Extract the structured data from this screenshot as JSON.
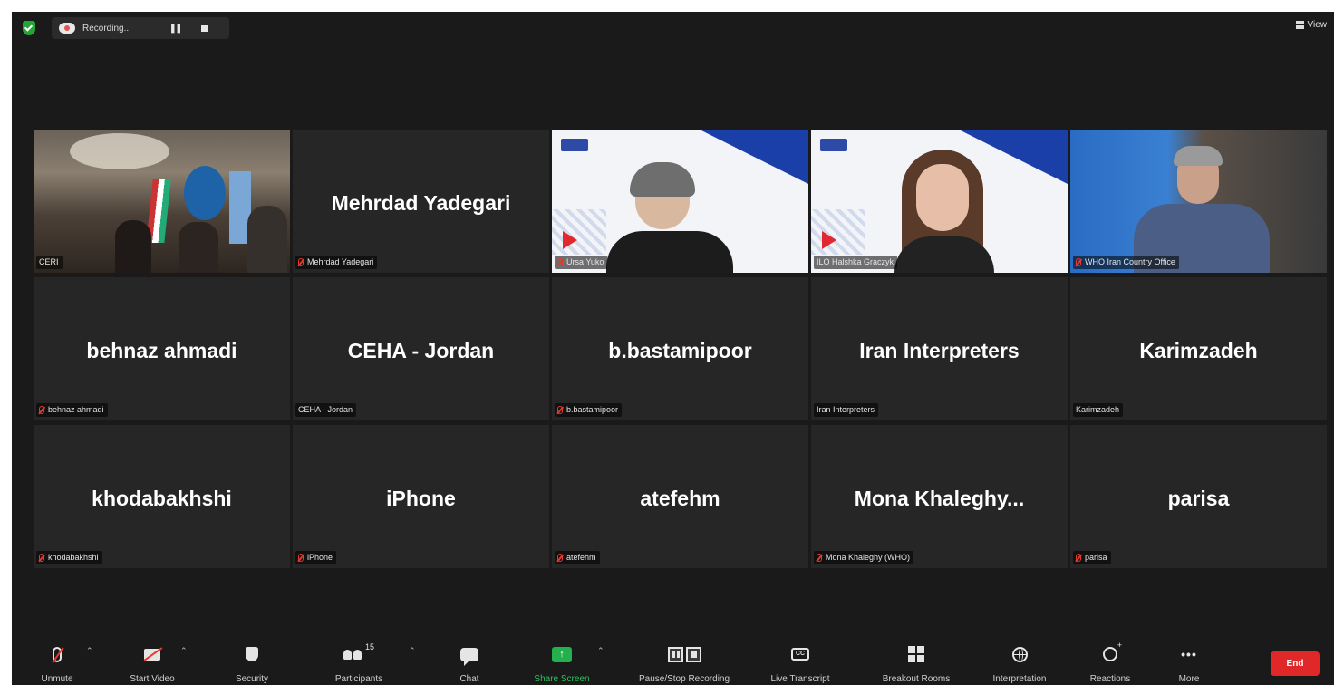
{
  "top_bar": {
    "recording_label": "Recording...",
    "view_label": "View"
  },
  "tiles": [
    {
      "label": "CERI",
      "video": "room",
      "active": true,
      "muted": false
    },
    {
      "name": "Mehrdad Yadegari",
      "label": "Mehrdad Yadegari",
      "muted": true
    },
    {
      "label": "Ursa Yuko",
      "video": "ilo-woman-short",
      "muted": true
    },
    {
      "label": "ILO Halshka Graczyk",
      "video": "ilo-woman-long",
      "muted": false
    },
    {
      "label": "WHO Iran Country Office",
      "video": "who-man",
      "muted": true
    },
    {
      "name": "behnaz ahmadi",
      "label": "behnaz ahmadi",
      "muted": true
    },
    {
      "name": "CEHA - Jordan",
      "label": "CEHA - Jordan",
      "muted": false
    },
    {
      "name": "b.bastamipoor",
      "label": "b.bastamipoor",
      "muted": true
    },
    {
      "name": "Iran Interpreters",
      "label": "Iran Interpreters",
      "muted": false
    },
    {
      "name": "Karimzadeh",
      "label": "Karimzadeh",
      "muted": false
    },
    {
      "name": "khodabakhshi",
      "label": "khodabakhshi",
      "muted": true
    },
    {
      "name": "iPhone",
      "label": "iPhone",
      "muted": true
    },
    {
      "name": "atefehm",
      "label": "atefehm",
      "muted": true
    },
    {
      "name": "Mona  Khaleghy...",
      "label": "Mona Khaleghy (WHO)",
      "muted": true
    },
    {
      "name": "parisa",
      "label": "parisa",
      "muted": true
    }
  ],
  "toolbar": {
    "unmute": "Unmute",
    "start_video": "Start Video",
    "security": "Security",
    "participants": "Participants",
    "participants_count": "15",
    "chat": "Chat",
    "share_screen": "Share Screen",
    "pause_stop_recording": "Pause/Stop Recording",
    "live_transcript": "Live Transcript",
    "breakout_rooms": "Breakout Rooms",
    "interpretation": "Interpretation",
    "reactions": "Reactions",
    "more": "More",
    "end": "End",
    "cc_glyph": "CC",
    "more_glyph": "•••",
    "share_glyph": "↑"
  },
  "colors": {
    "background": "#1a1a1a",
    "tile": "#262626",
    "active_border": "#d4e157",
    "muted_red": "#e5392e",
    "share_green": "#22b14c",
    "end_red": "#e02828"
  }
}
